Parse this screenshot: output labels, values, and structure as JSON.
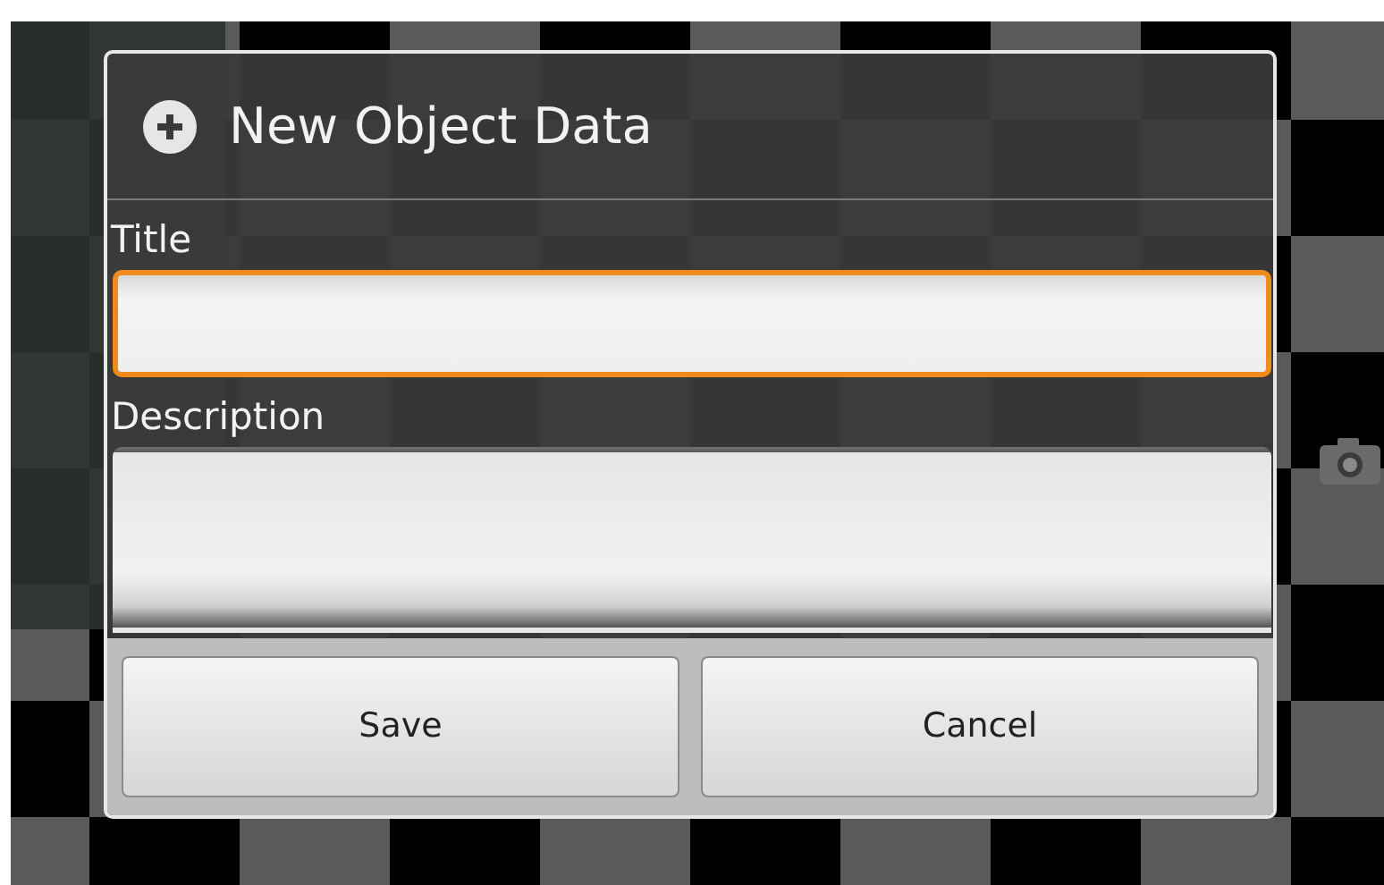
{
  "dialog": {
    "title": "New Object Data",
    "fields": [
      {
        "label": "Title",
        "kind": "single",
        "focused": true
      },
      {
        "label": "Description",
        "kind": "multi",
        "focused": false
      }
    ],
    "buttons": [
      "Save",
      "Cancel"
    ]
  }
}
